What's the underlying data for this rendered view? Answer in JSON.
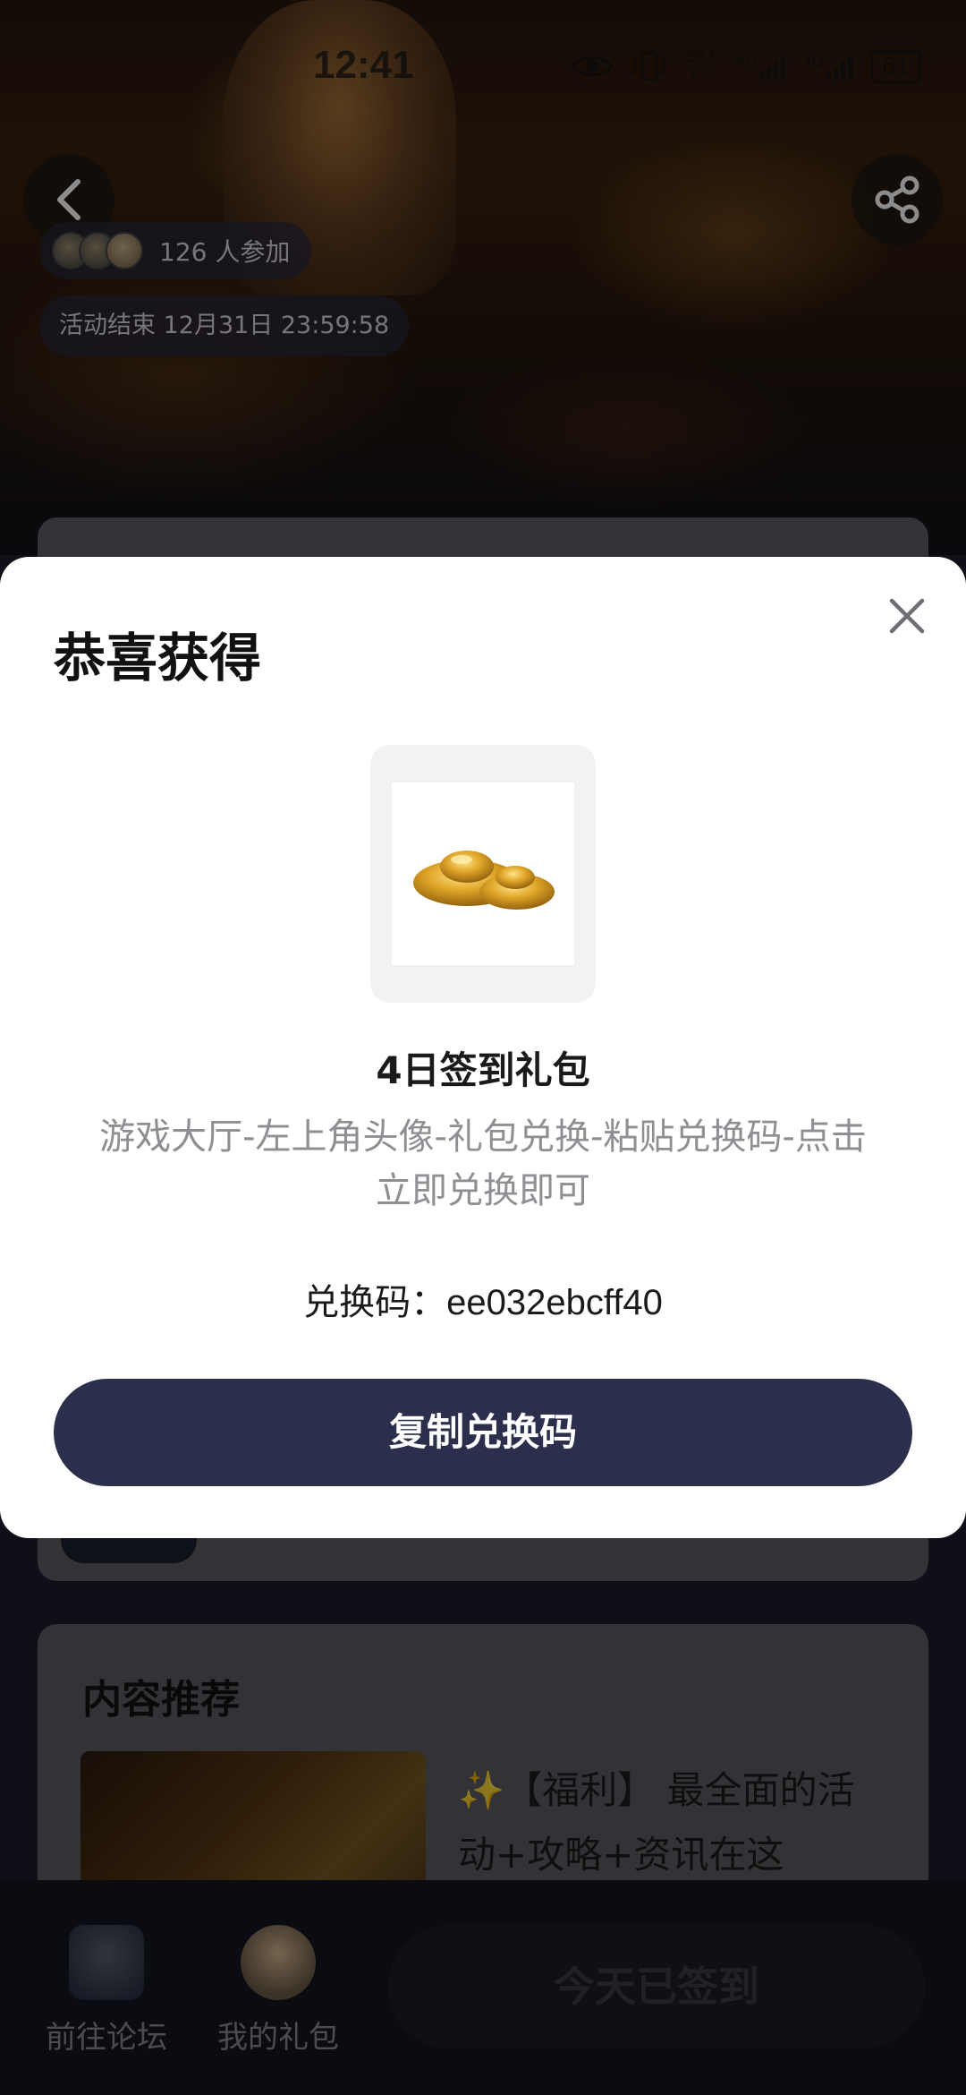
{
  "status_bar": {
    "time": "12:41",
    "net_speed_value": "23.6",
    "net_speed_unit": "K/s",
    "signal_1": "4G",
    "signal_2": "4G",
    "battery": "61"
  },
  "header": {
    "participants_text": "126 人参加",
    "end_time_text": "活动结束 12月31日 23:59:58"
  },
  "dialog": {
    "title": "恭喜获得",
    "gift_name": "4日签到礼包",
    "gift_desc": "游戏大厅-左上角头像-礼包兑换-粘贴兑换码-点击立即兑换即可",
    "code_label": "兑换码：",
    "code_value": "ee032ebcff40",
    "copy_button": "复制兑换码"
  },
  "recommend": {
    "title": "内容推荐",
    "sparkle": "✨",
    "article_text": "【福利】 最全面的活动+攻略+资讯在这"
  },
  "bottom_nav": {
    "forum_label": "前往论坛",
    "gift_label": "我的礼包",
    "signed_button": "今天已签到"
  },
  "colors": {
    "primary_button": "#2b2f4c",
    "dialog_bg": "#ffffff",
    "desc_text": "#8e8e93"
  }
}
